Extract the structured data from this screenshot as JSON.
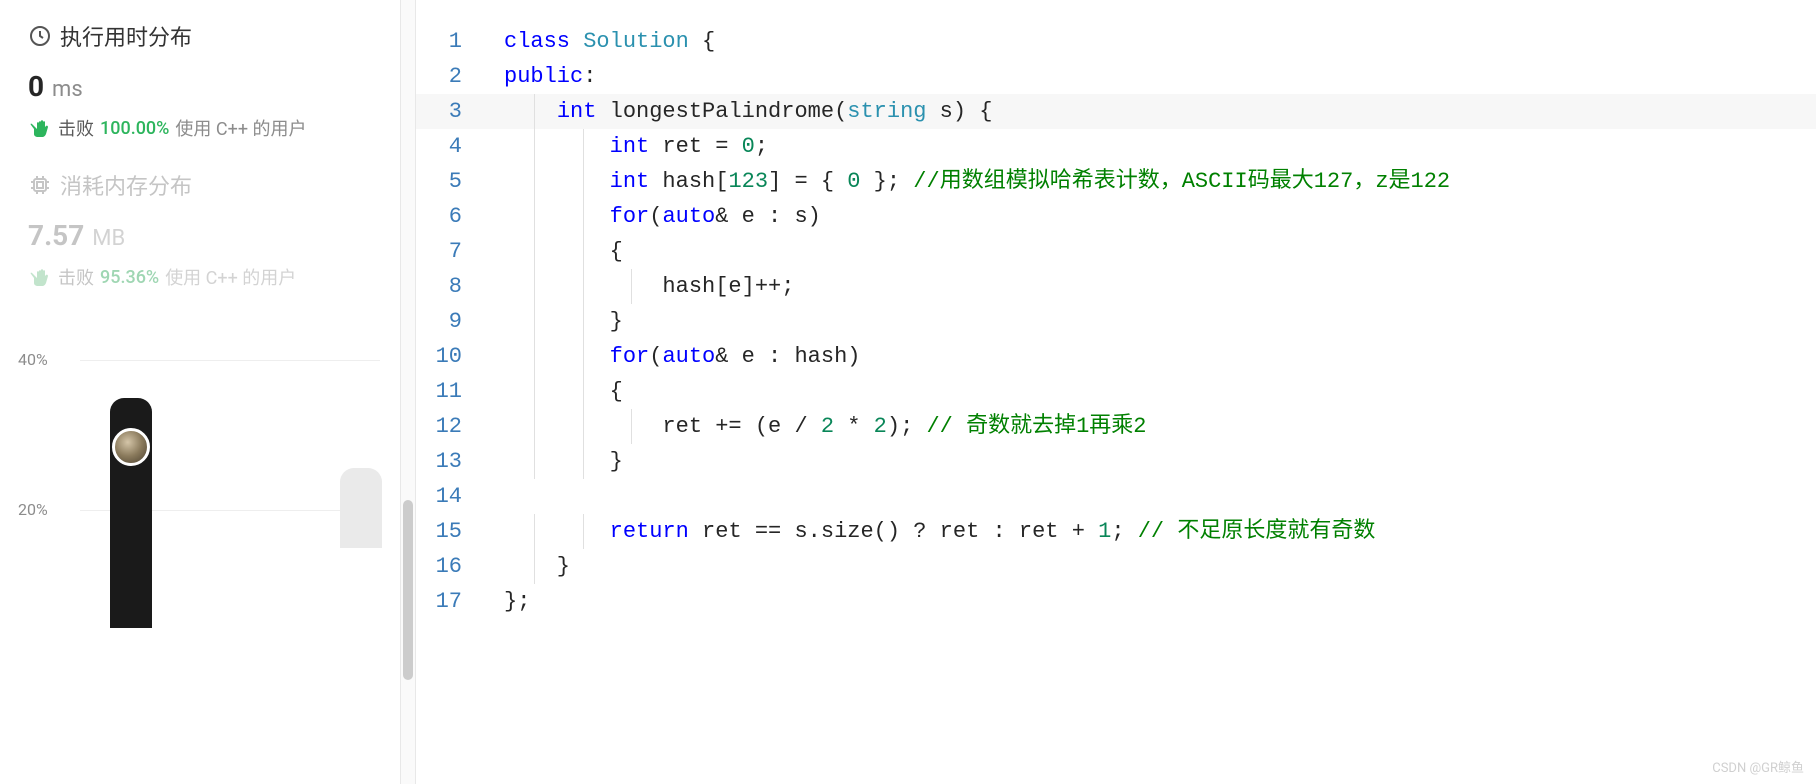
{
  "sidebar": {
    "runtime": {
      "title": "执行用时分布",
      "value": "0",
      "unit": "ms",
      "beat_label": "击败",
      "percent": "100.00%",
      "lang_text": "使用 C++ 的用户"
    },
    "memory": {
      "title": "消耗内存分布",
      "value": "7.57",
      "unit": "MB",
      "beat_label": "击败",
      "percent": "95.36%",
      "lang_text": "使用 C++ 的用户"
    },
    "chart": {
      "y_ticks": [
        "40%",
        "20%"
      ]
    }
  },
  "code": {
    "lines": [
      {
        "n": "1",
        "html": "<span class='kw-blue'>class</span> <span class='kw-teal'>Solution</span> {"
      },
      {
        "n": "2",
        "html": "<span class='kw-blue'>public</span>:"
      },
      {
        "n": "3",
        "hl": true,
        "html": "    <span class='kw-blue'>int</span> <span>longestPalindrome</span>(<span class='kw-teal'>string</span> s) {"
      },
      {
        "n": "4",
        "html": "        <span class='kw-blue'>int</span> ret = <span class='num'>0</span>;"
      },
      {
        "n": "5",
        "html": "        <span class='kw-blue'>int</span> hash[<span class='num'>123</span>] = { <span class='num'>0</span> }; <span class='comment'>//用数组模拟哈希表计数，ASCII码最大127，z是122</span>"
      },
      {
        "n": "6",
        "html": "        <span class='kw-blue'>for</span>(<span class='kw-blue'>auto</span>&amp; e : s)"
      },
      {
        "n": "7",
        "html": "        {"
      },
      {
        "n": "8",
        "html": "            hash[e]++;"
      },
      {
        "n": "9",
        "html": "        }"
      },
      {
        "n": "10",
        "html": "        <span class='kw-blue'>for</span>(<span class='kw-blue'>auto</span>&amp; e : hash)"
      },
      {
        "n": "11",
        "html": "        {"
      },
      {
        "n": "12",
        "html": "            ret += (e / <span class='num'>2</span> * <span class='num'>2</span>); <span class='comment'>// 奇数就去掉1再乘2</span>"
      },
      {
        "n": "13",
        "html": "        }"
      },
      {
        "n": "14",
        "html": ""
      },
      {
        "n": "15",
        "html": "        <span class='kw-blue'>return</span> ret == s.size() ? ret : ret + <span class='num'>1</span>; <span class='comment'>// 不足原长度就有奇数</span>"
      },
      {
        "n": "16",
        "html": "    }"
      },
      {
        "n": "17",
        "html": "};"
      }
    ]
  },
  "watermark": "CSDN @GR鲸鱼"
}
